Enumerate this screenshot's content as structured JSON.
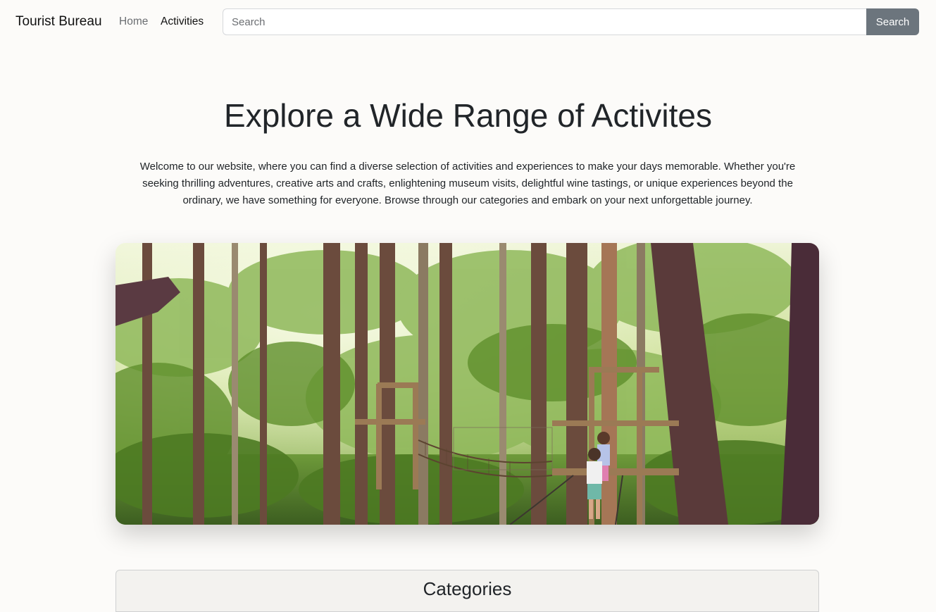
{
  "navbar": {
    "brand": "Tourist Bureau",
    "links": [
      {
        "label": "Home"
      },
      {
        "label": "Activities"
      }
    ],
    "search": {
      "placeholder": "Search",
      "value": "",
      "button_label": "Search"
    }
  },
  "hero": {
    "title": "Explore a Wide Range of Activites",
    "text": "Welcome to our website, where you can find a diverse selection of activities and experiences to make your days memorable. Whether you're seeking thrilling adventures, creative arts and crafts, enlightening museum visits, delightful wine tastings, or unique experiences beyond the ordinary, we have something for everyone. Browse through our categories and embark on your next unforgettable journey."
  },
  "categories": {
    "title": "Categories"
  },
  "colors": {
    "page_background": "#fcfbf9",
    "search_button": "#6c757d",
    "nav_inactive": "#6b6e72",
    "nav_active": "#111111"
  }
}
